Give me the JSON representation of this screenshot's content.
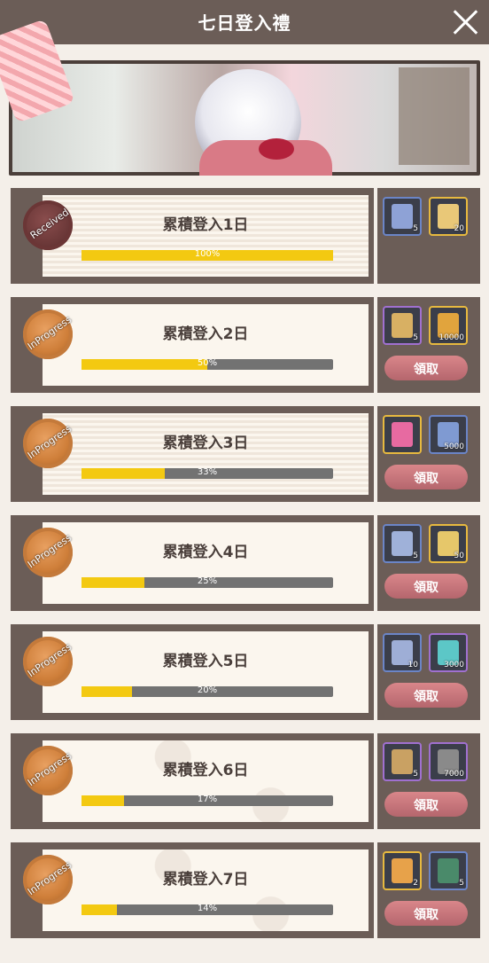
{
  "header": {
    "title": "七日登入禮"
  },
  "rows": [
    {
      "title": "累積登入1日",
      "status": "Received",
      "percent_label": "100%",
      "progress": 1.0,
      "items": [
        {
          "qty": "5"
        },
        {
          "qty": "20"
        }
      ],
      "claim_label": ""
    },
    {
      "title": "累積登入2日",
      "status": "InProgress",
      "percent_label": "50%",
      "progress": 0.5,
      "items": [
        {
          "qty": "5"
        },
        {
          "qty": "10000"
        }
      ],
      "claim_label": "領取"
    },
    {
      "title": "累積登入3日",
      "status": "InProgress",
      "percent_label": "33%",
      "progress": 0.33,
      "items": [
        {
          "qty": ""
        },
        {
          "qty": "5000"
        }
      ],
      "claim_label": "領取"
    },
    {
      "title": "累積登入4日",
      "status": "InProgress",
      "percent_label": "25%",
      "progress": 0.25,
      "items": [
        {
          "qty": "5"
        },
        {
          "qty": "50"
        }
      ],
      "claim_label": "領取"
    },
    {
      "title": "累積登入5日",
      "status": "InProgress",
      "percent_label": "20%",
      "progress": 0.2,
      "items": [
        {
          "qty": "10"
        },
        {
          "qty": "3000"
        }
      ],
      "claim_label": "領取"
    },
    {
      "title": "累積登入6日",
      "status": "InProgress",
      "percent_label": "17%",
      "progress": 0.17,
      "items": [
        {
          "qty": "5"
        },
        {
          "qty": "7000"
        }
      ],
      "claim_label": "領取"
    },
    {
      "title": "累積登入7日",
      "status": "InProgress",
      "percent_label": "14%",
      "progress": 0.14,
      "items": [
        {
          "qty": "2"
        },
        {
          "qty": "5"
        }
      ],
      "claim_label": "領取"
    }
  ],
  "colors": {
    "header": "#6b5d57",
    "fill": "#f3c911",
    "button": "#c47178"
  }
}
